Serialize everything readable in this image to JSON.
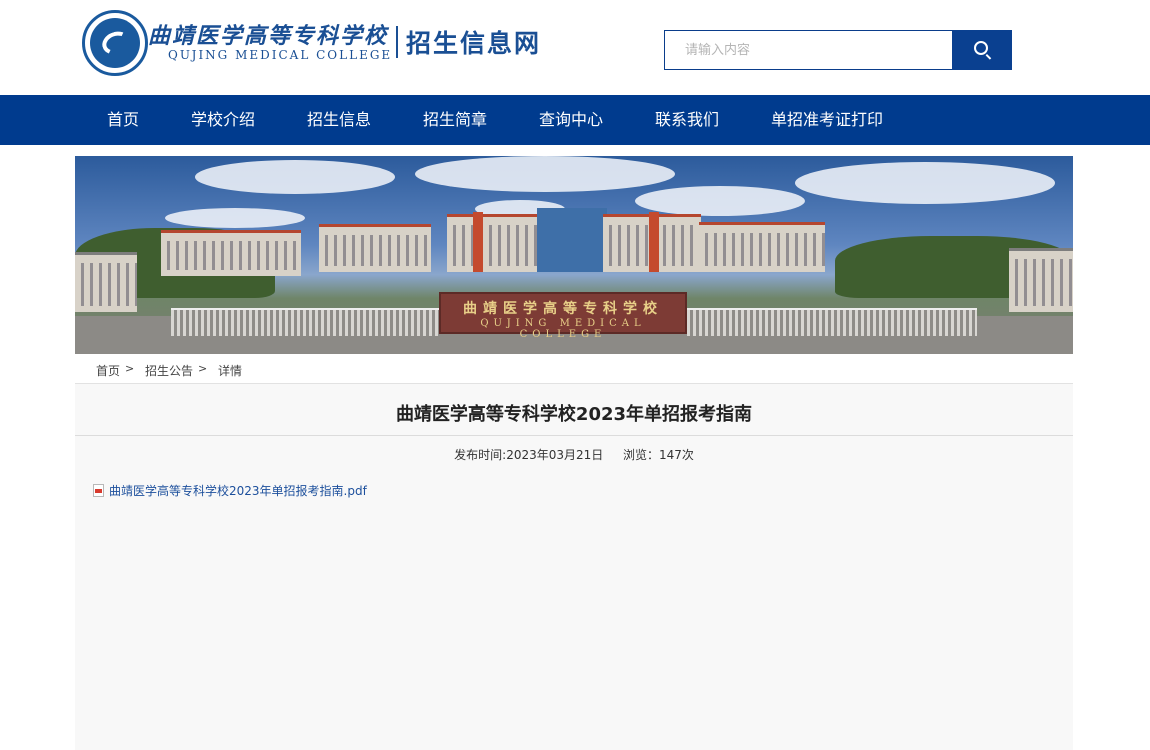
{
  "header": {
    "school_name_cn": "曲靖医学高等专科学校",
    "school_name_en": "QUJING MEDICAL COLLEGE",
    "site_name": "招生信息网",
    "search_placeholder": "请输入内容",
    "search_value": ""
  },
  "nav": {
    "items": [
      {
        "label": "首页"
      },
      {
        "label": "学校介绍"
      },
      {
        "label": "招生信息"
      },
      {
        "label": "招生简章"
      },
      {
        "label": "查询中心"
      },
      {
        "label": "联系我们"
      },
      {
        "label": "单招准考证打印"
      }
    ]
  },
  "banner": {
    "gate_sign_cn": "曲靖医学高等专科学校",
    "gate_sign_en": "QUJING MEDICAL COLLEGE"
  },
  "breadcrumb": {
    "items": [
      {
        "label": "首页"
      },
      {
        "label": "招生公告"
      },
      {
        "label": "详情"
      }
    ],
    "separator": ">"
  },
  "article": {
    "title": "曲靖医学高等专科学校2023年单招报考指南",
    "publish_label": "发布时间:2023年03月21日",
    "views_label": "浏览：147次",
    "attachment": "曲靖医学高等专科学校2023年单招报考指南.pdf"
  },
  "colors": {
    "nav_bg": "#003b8e",
    "brand_blue": "#1a4f94",
    "link": "#1c4f9c"
  }
}
